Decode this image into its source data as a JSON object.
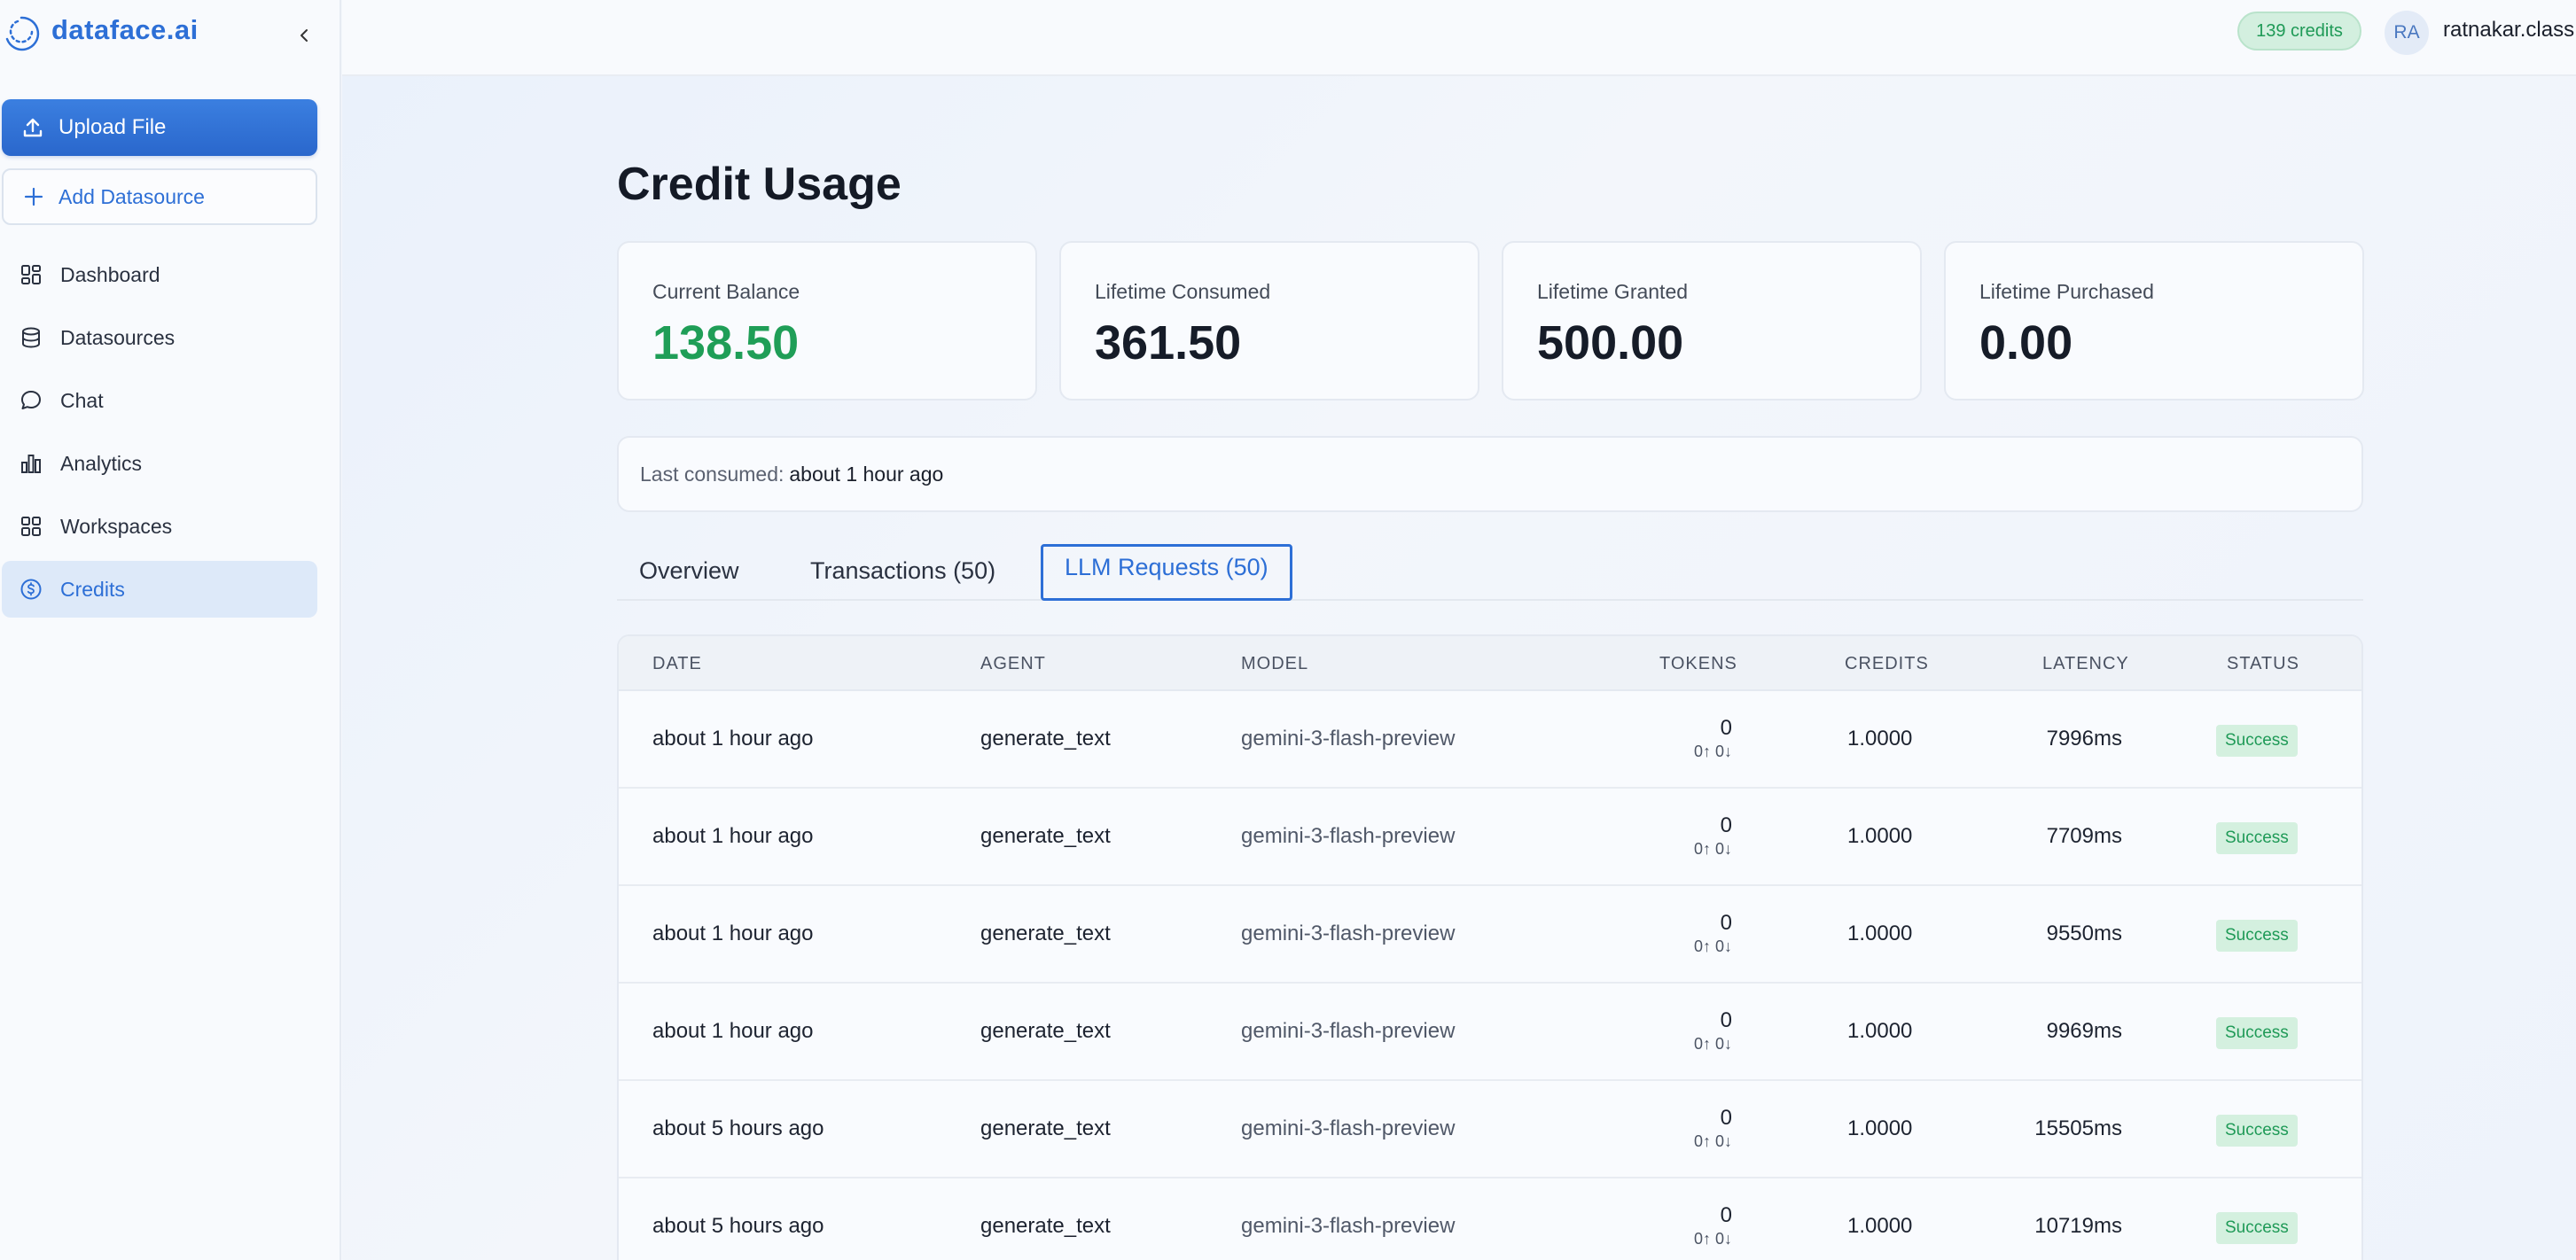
{
  "brand": {
    "name": "dataface.ai"
  },
  "sidebar": {
    "upload_label": "Upload File",
    "add_label": "Add Datasource",
    "items": [
      {
        "label": "Dashboard",
        "icon": "dashboard-icon"
      },
      {
        "label": "Datasources",
        "icon": "database-icon"
      },
      {
        "label": "Chat",
        "icon": "chat-icon"
      },
      {
        "label": "Analytics",
        "icon": "bar-chart-icon"
      },
      {
        "label": "Workspaces",
        "icon": "grid-icon"
      },
      {
        "label": "Credits",
        "icon": "dollar-circle-icon",
        "active": true
      }
    ]
  },
  "header": {
    "credits": "139 credits",
    "avatar_initials": "RA",
    "user": "ratnakar.class"
  },
  "page": {
    "title": "Credit Usage",
    "stats": [
      {
        "label": "Current Balance",
        "value": "138.50"
      },
      {
        "label": "Lifetime Consumed",
        "value": "361.50"
      },
      {
        "label": "Lifetime Granted",
        "value": "500.00"
      },
      {
        "label": "Lifetime Purchased",
        "value": "0.00"
      }
    ],
    "last_consumed_label": "Last consumed:",
    "last_consumed_value": "about 1 hour ago",
    "tabs": [
      {
        "label": "Overview"
      },
      {
        "label": "Transactions (50)"
      },
      {
        "label": "LLM Requests (50)",
        "active": true
      }
    ]
  },
  "table": {
    "columns": [
      "DATE",
      "AGENT",
      "MODEL",
      "TOKENS",
      "CREDITS",
      "LATENCY",
      "STATUS"
    ],
    "rows": [
      {
        "date": "about 1 hour ago",
        "agent": "generate_text",
        "model": "gemini-3-flash-preview",
        "tokens": "0",
        "tokens_detail": "0↑ 0↓",
        "credits": "1.0000",
        "latency": "7996ms",
        "status": "Success"
      },
      {
        "date": "about 1 hour ago",
        "agent": "generate_text",
        "model": "gemini-3-flash-preview",
        "tokens": "0",
        "tokens_detail": "0↑ 0↓",
        "credits": "1.0000",
        "latency": "7709ms",
        "status": "Success"
      },
      {
        "date": "about 1 hour ago",
        "agent": "generate_text",
        "model": "gemini-3-flash-preview",
        "tokens": "0",
        "tokens_detail": "0↑ 0↓",
        "credits": "1.0000",
        "latency": "9550ms",
        "status": "Success"
      },
      {
        "date": "about 1 hour ago",
        "agent": "generate_text",
        "model": "gemini-3-flash-preview",
        "tokens": "0",
        "tokens_detail": "0↑ 0↓",
        "credits": "1.0000",
        "latency": "9969ms",
        "status": "Success"
      },
      {
        "date": "about 5 hours ago",
        "agent": "generate_text",
        "model": "gemini-3-flash-preview",
        "tokens": "0",
        "tokens_detail": "0↑ 0↓",
        "credits": "1.0000",
        "latency": "15505ms",
        "status": "Success"
      },
      {
        "date": "about 5 hours ago",
        "agent": "generate_text",
        "model": "gemini-3-flash-preview",
        "tokens": "0",
        "tokens_detail": "0↑ 0↓",
        "credits": "1.0000",
        "latency": "10719ms",
        "status": "Success"
      }
    ]
  },
  "colors": {
    "accent": "#2d6fd6",
    "success": "#1f9e57",
    "success_bg": "#d4f0df"
  }
}
